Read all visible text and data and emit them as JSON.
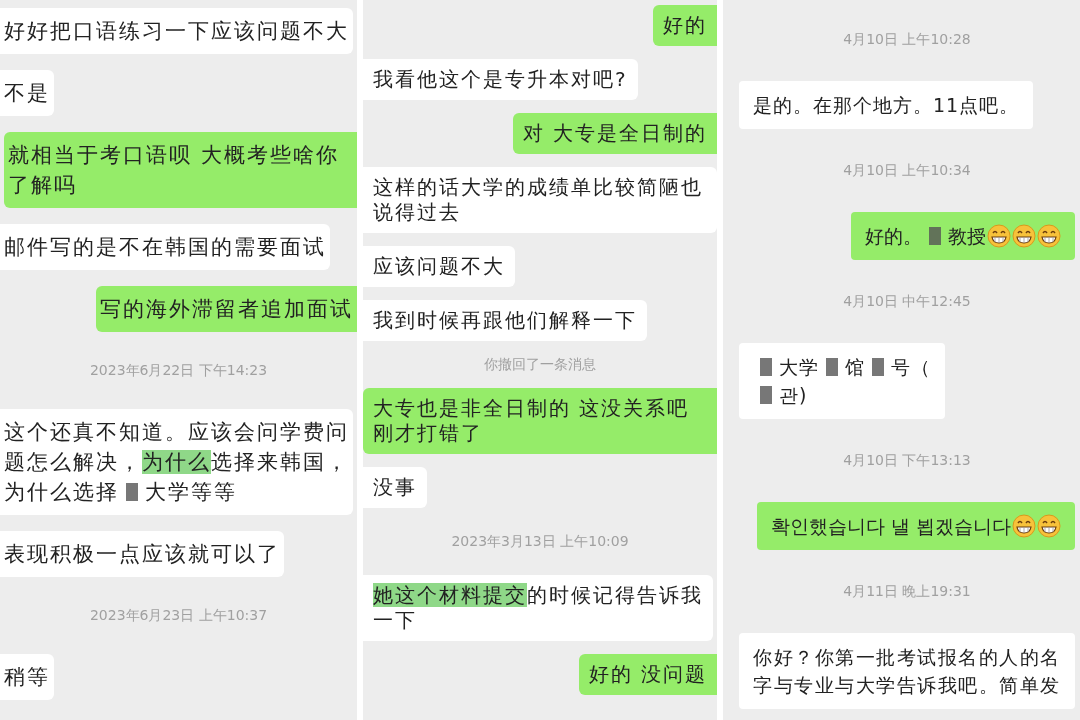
{
  "columns": [
    {
      "items": [
        {
          "kind": "in",
          "text": "好好把口语练习一下应该问题不大"
        },
        {
          "kind": "in",
          "text": "不是"
        },
        {
          "kind": "out",
          "wide": true,
          "text": "就相当于考口语呗 大概考些啥你了解吗"
        },
        {
          "kind": "in",
          "text": "邮件写的是不在韩国的需要面试"
        },
        {
          "kind": "out",
          "text": "写的海外滞留者追加面试"
        },
        {
          "kind": "time",
          "text": "2023年6月22日 下午14:23"
        },
        {
          "kind": "in",
          "lines": [
            [
              {
                "kind": "text",
                "text": "这个还真不知道。应该会问学费问"
              }
            ],
            [
              {
                "kind": "text",
                "text": "题怎么解决，"
              },
              {
                "kind": "highlight",
                "text": "为什么"
              },
              {
                "kind": "text",
                "text": "选择来韩国，"
              }
            ],
            [
              {
                "kind": "text",
                "text": "为什么选择"
              },
              {
                "kind": "redacted"
              },
              {
                "kind": "text",
                "text": "大学等等"
              }
            ]
          ]
        },
        {
          "kind": "in",
          "text": "表现积极一点应该就可以了"
        },
        {
          "kind": "time",
          "text": "2023年6月23日 上午10:37"
        },
        {
          "kind": "in",
          "text": "稍等"
        }
      ]
    },
    {
      "items": [
        {
          "kind": "out",
          "text": "好的"
        },
        {
          "kind": "in",
          "text": "我看他这个是专升本对吧?"
        },
        {
          "kind": "out",
          "text": "对  大专是全日制的"
        },
        {
          "kind": "in",
          "text": "这样的话大学的成绩单比较简陋也说得过去"
        },
        {
          "kind": "in",
          "text": "应该问题不大"
        },
        {
          "kind": "in",
          "text": "我到时候再跟他们解释一下"
        },
        {
          "kind": "notice",
          "text": "你撤回了一条消息"
        },
        {
          "kind": "out",
          "wide": true,
          "text": "大专也是非全日制的  这没关系吧刚才打错了"
        },
        {
          "kind": "in",
          "text": "没事"
        },
        {
          "kind": "time",
          "text": "2023年3月13日 上午10:09"
        },
        {
          "kind": "in",
          "lines": [
            [
              {
                "kind": "highlight",
                "text": "她这个材料提交"
              },
              {
                "kind": "text",
                "text": "的时候记得告诉我"
              }
            ],
            [
              {
                "kind": "text",
                "text": "一下"
              }
            ]
          ]
        },
        {
          "kind": "out",
          "text": "好的 没问题"
        }
      ]
    },
    {
      "items": [
        {
          "kind": "time",
          "text": "4月10日 上午10:28"
        },
        {
          "kind": "in",
          "text": "是的。在那个地方。11点吧。"
        },
        {
          "kind": "time",
          "text": "4月10日 上午10:34"
        },
        {
          "kind": "out",
          "lines": [
            [
              {
                "kind": "text",
                "text": "好的。"
              },
              {
                "kind": "redacted"
              },
              {
                "kind": "text",
                "text": "教授"
              },
              {
                "kind": "emoji"
              },
              {
                "kind": "emoji"
              },
              {
                "kind": "emoji"
              }
            ]
          ]
        },
        {
          "kind": "time",
          "text": "4月10日 中午12:45"
        },
        {
          "kind": "in",
          "lines": [
            [
              {
                "kind": "redacted"
              },
              {
                "kind": "text",
                "text": "大学"
              },
              {
                "kind": "redacted"
              },
              {
                "kind": "text",
                "text": "馆"
              },
              {
                "kind": "redacted"
              },
              {
                "kind": "text",
                "text": "号（"
              }
            ],
            [
              {
                "kind": "redacted"
              },
              {
                "kind": "text",
                "text": "관)"
              }
            ]
          ]
        },
        {
          "kind": "time",
          "text": "4月10日 下午13:13"
        },
        {
          "kind": "out",
          "lines": [
            [
              {
                "kind": "text",
                "text": "확인했습니다 낼 뵙겠습니다"
              },
              {
                "kind": "emoji"
              },
              {
                "kind": "emoji"
              }
            ]
          ]
        },
        {
          "kind": "time",
          "text": "4月11日 晚上19:31"
        },
        {
          "kind": "in",
          "text": "你好？你第一批考试报名的人的名字与专业与大学告诉我吧。简单发"
        }
      ]
    }
  ]
}
